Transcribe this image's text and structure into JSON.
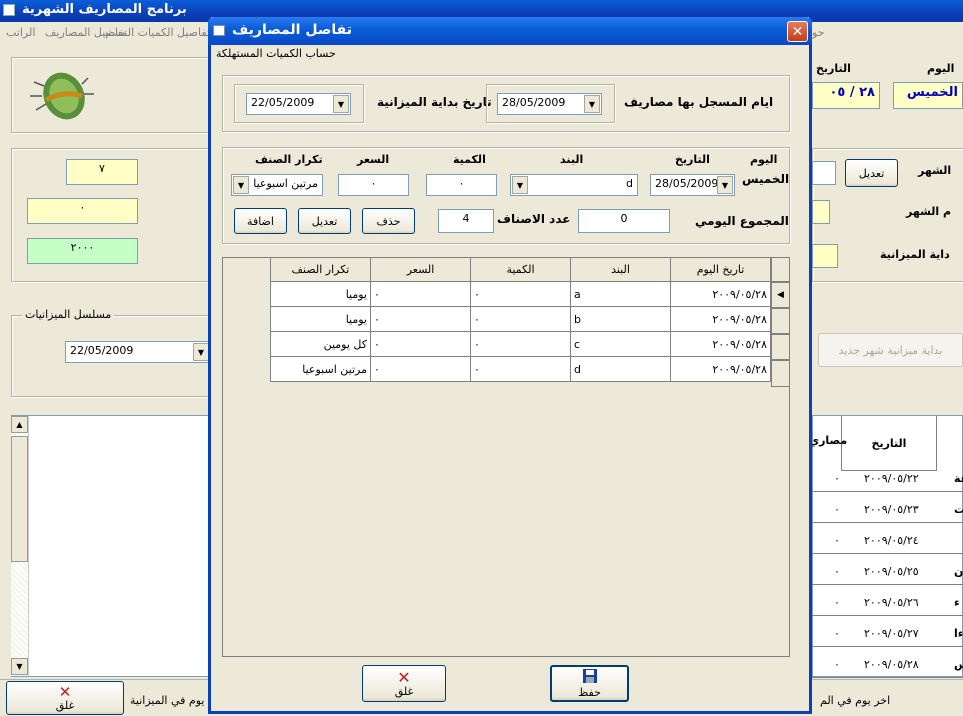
{
  "main": {
    "title": "برنامج المصاريف الشهرية",
    "menu": [
      "الراتب",
      "تفاصيل المصاريف",
      "تفاصيل الكميات المستهلكة",
      "حو"
    ],
    "day_label": "اليوم",
    "day_value": "الخميس",
    "date_label": "التاريخ",
    "date_value": "٢٨ / ٠٥",
    "edit_button": "تعديل",
    "labels": [
      "الشهر",
      "م الشهر",
      "داية الميزانية"
    ],
    "values": [
      "٧",
      "٠",
      "٢٠٠٠"
    ],
    "budget_series": {
      "caption": "مسلسل الميزانيات",
      "value": "22/05/2009"
    },
    "new_month_button": "بداية ميزانية شهر جديد",
    "table": {
      "headers": [
        "التاريخ",
        "مصاري"
      ],
      "rows": [
        {
          "date": "٢٠٠٩/٠٥/٢٢",
          "amount": "٠",
          "day": "عة"
        },
        {
          "date": "٢٠٠٩/٠٥/٢٣",
          "amount": "٠",
          "day": "ت"
        },
        {
          "date": "٢٠٠٩/٠٥/٢٤",
          "amount": "٠",
          "day": ""
        },
        {
          "date": "٢٠٠٩/٠٥/٢٥",
          "amount": "٠",
          "day": "ن"
        },
        {
          "date": "٢٠٠٩/٠٥/٢٦",
          "amount": "٠",
          "day": "ء"
        },
        {
          "date": "٢٠٠٩/٠٥/٢٧",
          "amount": "٠",
          "day": "ءا"
        },
        {
          "date": "٢٠٠٩/٠٥/٢٨",
          "amount": "٠",
          "day": "س"
        }
      ]
    },
    "close_button": "غلق",
    "bottom_left_label": "يوم في الميزانية",
    "bottom_right_label": "اخر يوم في الم"
  },
  "dialog": {
    "title": "تفاصل المصاريف",
    "subtitle": "حساب الكميات المستهلكة",
    "days_with_expenses_label": "ايام المسجل بها مصاريف",
    "days_with_expenses_value": "28/05/2009",
    "budget_start_label": "تاريخ بداية الميزانية",
    "budget_start_value": "22/05/2009",
    "form": {
      "day_label": "اليوم",
      "day_value": "الخميس",
      "date_label": "التاريخ",
      "date_value": "28/05/2009",
      "item_label": "البند",
      "item_value": "d",
      "qty_label": "الكمية",
      "qty_value": "٠",
      "price_label": "السعر",
      "price_value": "٠",
      "repeat_label": "تكرار الصنف",
      "repeat_value": "مرتين اسبوعيا",
      "daily_total_label": "المجموع اليومي",
      "daily_total_value": "0",
      "item_count_label": "عدد الاصناف",
      "item_count_value": "4",
      "delete_button": "حذف",
      "edit_button": "تعديل",
      "add_button": "اضافة"
    },
    "grid": {
      "headers": [
        "تاريخ اليوم",
        "البند",
        "الكمية",
        "السعر",
        "تكرار الصنف"
      ],
      "rows": [
        {
          "date": "٢٠٠٩/٠٥/٢٨",
          "item": "a",
          "qty": "٠",
          "price": "٠",
          "repeat": "يوميا"
        },
        {
          "date": "٢٠٠٩/٠٥/٢٨",
          "item": "b",
          "qty": "٠",
          "price": "٠",
          "repeat": "يوميا"
        },
        {
          "date": "٢٠٠٩/٠٥/٢٨",
          "item": "c",
          "qty": "٠",
          "price": "٠",
          "repeat": "كل يومين"
        },
        {
          "date": "٢٠٠٩/٠٥/٢٨",
          "item": "d",
          "qty": "٠",
          "price": "٠",
          "repeat": "مرتين اسبوعيا"
        }
      ]
    },
    "close_button": "غلق",
    "save_button": "حفظ"
  },
  "colors": {
    "titlebar": "#0a48c8",
    "yellow_field": "#ffffc6",
    "green_field": "#c6ffc6",
    "close_red": "#c53b1a"
  }
}
